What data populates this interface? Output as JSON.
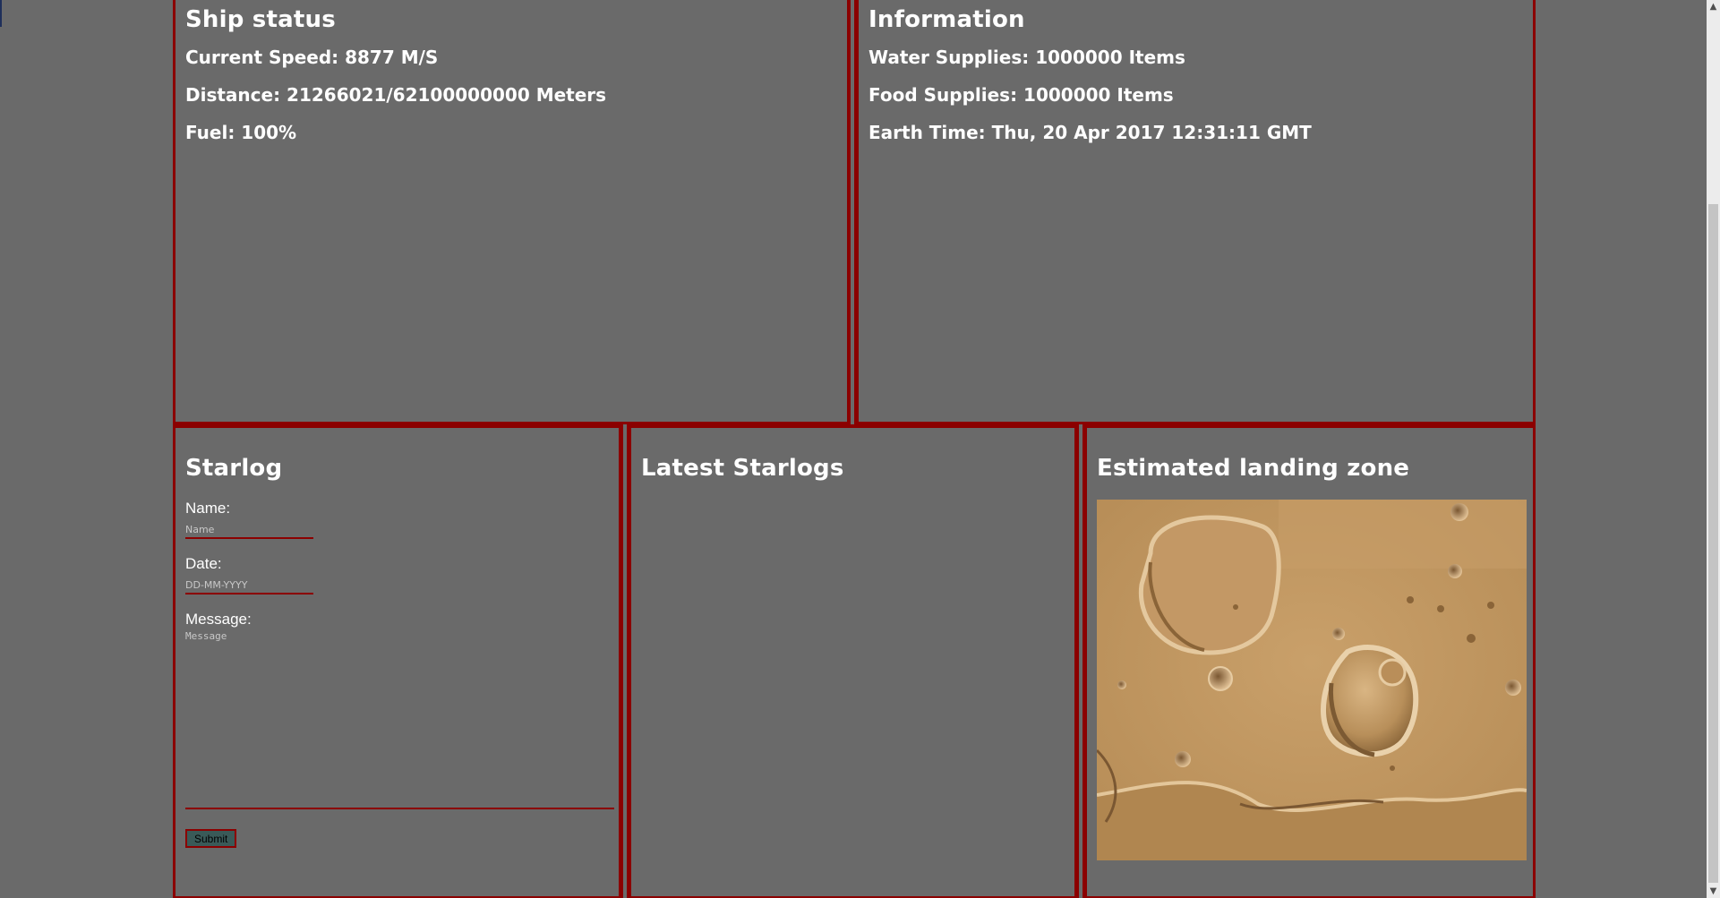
{
  "ship_status": {
    "title": "Ship status",
    "current_speed": "Current Speed: 8877 M/S",
    "distance": "Distance: 21266021/62100000000 Meters",
    "fuel": "Fuel: 100%"
  },
  "information": {
    "title": "Information",
    "water": "Water Supplies: 1000000 Items",
    "food": "Food Supplies: 1000000 Items",
    "earth_time": "Earth Time: Thu, 20 Apr 2017 12:31:11 GMT"
  },
  "starlog": {
    "title": "Starlog",
    "name_label": "Name:",
    "name_placeholder": "Name",
    "date_label": "Date:",
    "date_placeholder": "DD-MM-YYYY",
    "message_label": "Message:",
    "message_placeholder": "Message",
    "submit_label": "Submit"
  },
  "latest_starlogs": {
    "title": "Latest Starlogs"
  },
  "landing_zone": {
    "title": "Estimated landing zone",
    "image": "mars-crater-surface"
  },
  "colors": {
    "background": "#6a6a6a",
    "border": "#8b0000",
    "text": "#ffffff",
    "button": "#3a5a58"
  }
}
